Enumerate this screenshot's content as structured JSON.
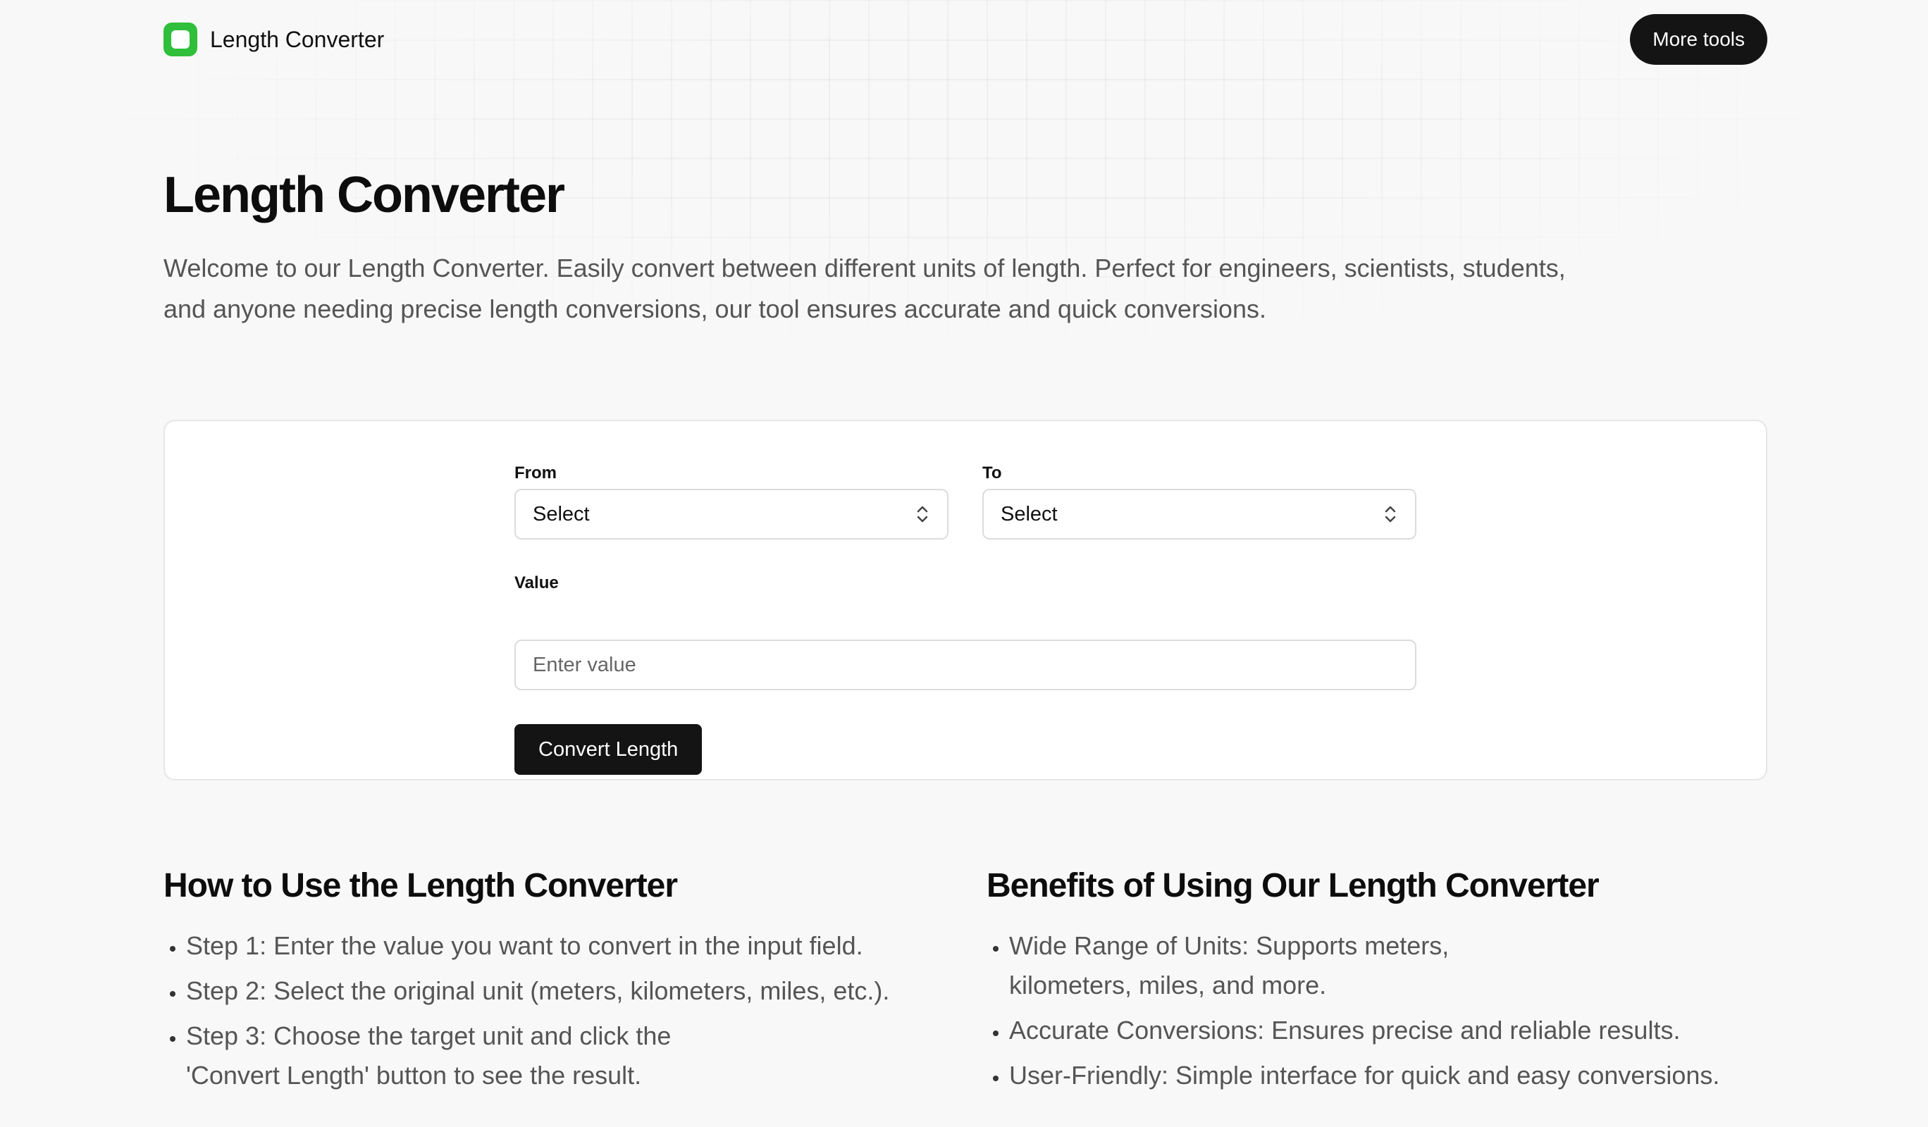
{
  "header": {
    "brand_name": "Length Converter",
    "more_tools_label": "More tools",
    "logo_icon": "rounded-square-logo-icon",
    "accent_color": "#2fbf3a"
  },
  "hero": {
    "title": "Length Converter",
    "description": "Welcome to our Length Converter. Easily convert between different units of length. Perfect for engineers, scientists, students, and anyone needing precise length conversions, our tool ensures accurate and quick conversions."
  },
  "form": {
    "from_label": "From",
    "from_value": "Select",
    "to_label": "To",
    "to_value": "Select",
    "value_label": "Value",
    "value_placeholder": "Enter value",
    "value_current": "",
    "convert_label": "Convert Length"
  },
  "how_to": {
    "title": "How to Use the Length Converter",
    "steps": [
      "Step 1: Enter the value you want to convert in the input field.",
      "Step 2: Select the original unit (meters, kilometers, miles, etc.).",
      "Step 3: Choose the target unit and click the 'Convert Length' button to see the result."
    ]
  },
  "benefits": {
    "title": "Benefits of Using Our Length Converter",
    "items": [
      "Wide Range of Units: Supports meters, kilometers, miles, and more.",
      "Accurate Conversions: Ensures precise and reliable results.",
      "User-Friendly: Simple interface for quick and easy conversions."
    ]
  }
}
